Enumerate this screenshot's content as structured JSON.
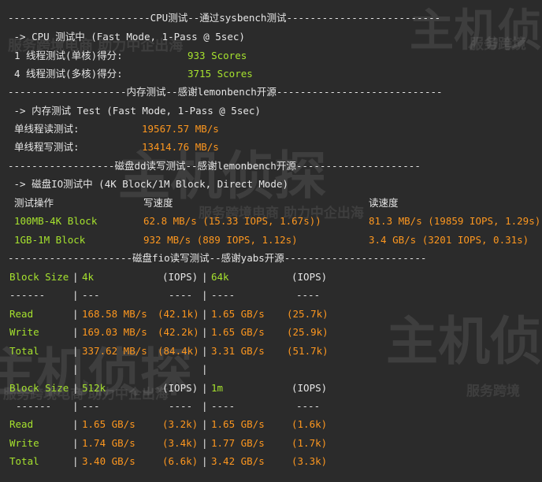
{
  "watermarks": {
    "brand_big": "主机侦探",
    "brand_small": "服务跨境电商 助力中企出海",
    "short_small": "服务跨境"
  },
  "cpu": {
    "header": "------------------------CPU测试--通过sysbench测试--------------------------",
    "mode": " -> CPU 测试中 (Fast Mode, 1-Pass @ 5sec)",
    "single_label": "1 线程测试(单核)得分:",
    "single_value": "933 Scores",
    "multi_label": "4 线程测试(多核)得分:",
    "multi_value": "3715 Scores"
  },
  "memory": {
    "header": "--------------------内存测试--感谢lemonbench开源----------------------------",
    "mode": " -> 内存测试 Test (Fast Mode, 1-Pass @ 5sec)",
    "read_label": "单线程读测试:",
    "read_value": "19567.57 MB/s",
    "write_label": "单线程写测试:",
    "write_value": "13414.76 MB/s"
  },
  "disk_dd": {
    "header": "------------------磁盘dd读写测试--感谢lemonbench开源---------------------",
    "mode": " -> 磁盘IO测试中 (4K Block/1M Block, Direct Mode)",
    "col_op": "测试操作",
    "col_write": "写速度",
    "col_read": "读速度",
    "rows": [
      {
        "op": "100MB-4K Block",
        "write": "62.8 MB/s (15.33 IOPS, 1.67s))",
        "read": "81.3 MB/s (19859 IOPS, 1.29s)"
      },
      {
        "op": "1GB-1M Block",
        "write": "932 MB/s (889 IOPS, 1.12s)",
        "read": "3.4 GB/s (3201 IOPS, 0.31s)"
      }
    ]
  },
  "disk_fio": {
    "header": "---------------------磁盘fio读写测试--感谢yabs开源------------------------",
    "tables": [
      {
        "head": {
          "label": "Block Size",
          "bs1": "4k",
          "iops1": "(IOPS)",
          "bs2": "64k",
          "iops2": "(IOPS)"
        },
        "sep": {
          "label": "------",
          "bs1": "---",
          "iops1": "----",
          "bs2": "----",
          "iops2": "----"
        },
        "rows": [
          {
            "label": "Read",
            "v1": "168.58 MB/s",
            "i1": "(42.1k)",
            "v2": "1.65 GB/s",
            "i2": "(25.7k)"
          },
          {
            "label": "Write",
            "v1": "169.03 MB/s",
            "i1": "(42.2k)",
            "v2": "1.65 GB/s",
            "i2": "(25.9k)"
          },
          {
            "label": "Total",
            "v1": "337.62 MB/s",
            "i1": "(84.4k)",
            "v2": "3.31 GB/s",
            "i2": "(51.7k)"
          }
        ]
      },
      {
        "head": {
          "label": "Block Size",
          "bs1": "512k",
          "iops1": "(IOPS)",
          "bs2": "1m",
          "iops2": "(IOPS)"
        },
        "sep": {
          "label": "------",
          "bs1": "---",
          "iops1": "----",
          "bs2": "----",
          "iops2": "----"
        },
        "rows": [
          {
            "label": "Read",
            "v1": "1.65 GB/s",
            "i1": "(3.2k)",
            "v2": "1.65 GB/s",
            "i2": "(1.6k)"
          },
          {
            "label": "Write",
            "v1": "1.74 GB/s",
            "i1": "(3.4k)",
            "v2": "1.77 GB/s",
            "i2": "(1.7k)"
          },
          {
            "label": "Total",
            "v1": "3.40 GB/s",
            "i1": "(6.6k)",
            "v2": "3.42 GB/s",
            "i2": "(3.3k)"
          }
        ]
      }
    ]
  }
}
